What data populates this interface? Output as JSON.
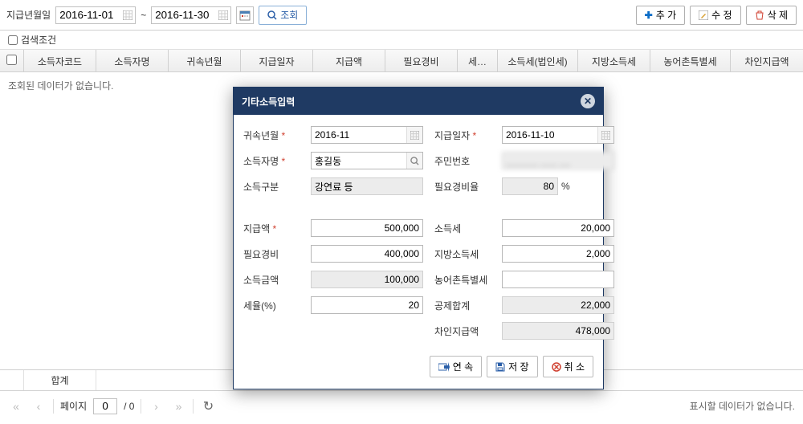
{
  "toolbar": {
    "date_label": "지급년월일",
    "date_from": "2016-11-01",
    "date_to": "2016-11-30",
    "tilde": "~",
    "search_label": "조회",
    "add_label": "추 가",
    "edit_label": "수 정",
    "del_label": "삭 제"
  },
  "filter": {
    "label": "검색조건"
  },
  "grid": {
    "headers": [
      "소득자코드",
      "소득자명",
      "귀속년월",
      "지급일자",
      "지급액",
      "필요경비",
      "세…",
      "소득세(법인세)",
      "지방소득세",
      "농어촌특별세",
      "차인지급액"
    ],
    "empty_text": "조회된 데이터가 없습니다."
  },
  "summary": {
    "label": "합계"
  },
  "pager": {
    "page_label": "페이지",
    "page_value": "0",
    "page_total": "/ 0",
    "right_text": "표시할 데이터가 없습니다."
  },
  "modal": {
    "title": "기타소득입력",
    "labels": {
      "attr_month": "귀속년월",
      "pay_date": "지급일자",
      "earner_name": "소득자명",
      "resident_no": "주민번호",
      "income_type": "소득구분",
      "expense_rate": "필요경비율",
      "pay_amount": "지급액",
      "income_tax": "소득세",
      "expense": "필요경비",
      "local_tax": "지방소득세",
      "income_amount": "소득금액",
      "rural_tax": "농어촌특별세",
      "tax_rate": "세율(%)",
      "deduct_total": "공제합계",
      "net_pay": "차인지급액",
      "percent": "%"
    },
    "values": {
      "attr_month": "2016-11",
      "pay_date": "2016-11-10",
      "earner_name": "홍길동",
      "resident_no": "______ ___ __",
      "income_type": "강연료 등",
      "expense_rate": "80",
      "pay_amount": "500,000",
      "income_tax": "20,000",
      "expense": "400,000",
      "local_tax": "2,000",
      "income_amount": "100,000",
      "rural_tax": "",
      "tax_rate": "20",
      "deduct_total": "22,000",
      "net_pay": "478,000"
    },
    "buttons": {
      "continuous": "연 속",
      "save": "저 장",
      "cancel": "취 소"
    }
  }
}
